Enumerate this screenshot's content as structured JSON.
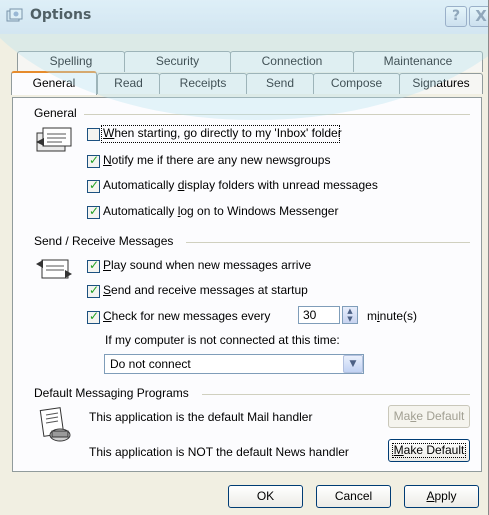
{
  "window": {
    "title": "Options",
    "help_glyph": "?",
    "close_glyph": "X"
  },
  "tabs": {
    "row1": [
      "Spelling",
      "Security",
      "Connection",
      "Maintenance"
    ],
    "row2": [
      "General",
      "Read",
      "Receipts",
      "Send",
      "Compose",
      "Signatures"
    ],
    "active": "General"
  },
  "general": {
    "label": "General",
    "options": [
      {
        "pre": "",
        "ul": "W",
        "post": "hen starting, go directly to my 'Inbox' folder",
        "checked": false
      },
      {
        "pre": "",
        "ul": "N",
        "post": "otify me if there are any new newsgroups",
        "checked": true
      },
      {
        "pre": "Automatically ",
        "ul": "d",
        "post": "isplay folders with unread messages",
        "checked": true
      },
      {
        "pre": "Automatically ",
        "ul": "l",
        "post": "og on to Windows Messenger",
        "checked": true
      }
    ]
  },
  "send_receive": {
    "label": "Send / Receive Messages",
    "options": [
      {
        "pre": "",
        "ul": "P",
        "post": "lay sound when new messages arrive",
        "checked": true
      },
      {
        "pre": "",
        "ul": "S",
        "post": "end and receive messages at startup",
        "checked": true
      },
      {
        "pre": "",
        "ul": "C",
        "post": "heck for new messages every",
        "checked": true
      }
    ],
    "interval_value": "30",
    "interval_unit_pre": "m",
    "interval_unit_ul": "i",
    "interval_unit_post": "nute(s)",
    "not_connected_label": "If my computer is not connected at this time:",
    "connect_value": "Do not connect"
  },
  "default_programs": {
    "label": "Default Messaging Programs",
    "mail_text": "This application is the default Mail handler",
    "news_text": "This application is NOT the default News handler",
    "make_default_pre": "Ma",
    "make_default_ul": "k",
    "make_default_post": "e Default",
    "make_default2_pre": "",
    "make_default2_ul": "M",
    "make_default2_post": "ake Default"
  },
  "footer": {
    "ok": "OK",
    "cancel": "Cancel",
    "apply_ul": "A",
    "apply_post": "pply"
  },
  "colors": {
    "tab_highlight": "#e68b2c",
    "checkmark": "#21a121",
    "dialog_bg": "#f1efe2"
  }
}
